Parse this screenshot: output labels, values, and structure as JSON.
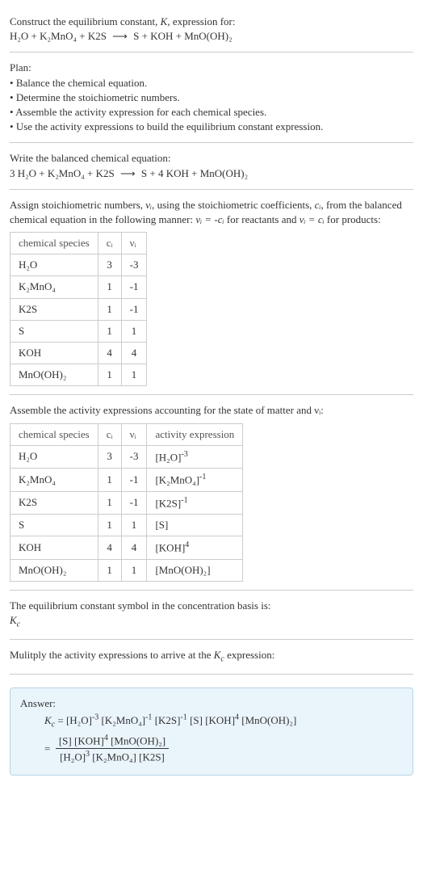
{
  "intro": {
    "line1": "Construct the equilibrium constant, ",
    "k": "K",
    "line1b": ", expression for:",
    "eq_lhs": "H₂O + K₂MnO₄ + K2S",
    "arrow": "⟶",
    "eq_rhs": "S + KOH + MnO(OH)₂"
  },
  "plan": {
    "heading": "Plan:",
    "items": [
      "Balance the chemical equation.",
      "Determine the stoichiometric numbers.",
      "Assemble the activity expression for each chemical species.",
      "Use the activity expressions to build the equilibrium constant expression."
    ]
  },
  "balanced": {
    "heading": "Write the balanced chemical equation:",
    "eq_lhs": "3 H₂O + K₂MnO₄ + K2S",
    "arrow": "⟶",
    "eq_rhs": "S + 4 KOH + MnO(OH)₂"
  },
  "assign": {
    "text1": "Assign stoichiometric numbers, ",
    "nu": "νᵢ",
    "text2": ", using the stoichiometric coefficients, ",
    "ci": "cᵢ",
    "text3": ", from the balanced chemical equation in the following manner: ",
    "rel1": "νᵢ = -cᵢ",
    "text4": " for reactants and ",
    "rel2": "νᵢ = cᵢ",
    "text5": " for products:"
  },
  "table1": {
    "headers": [
      "chemical species",
      "cᵢ",
      "νᵢ"
    ],
    "rows": [
      {
        "sp": "H₂O",
        "c": "3",
        "v": "-3"
      },
      {
        "sp": "K₂MnO₄",
        "c": "1",
        "v": "-1"
      },
      {
        "sp": "K2S",
        "c": "1",
        "v": "-1"
      },
      {
        "sp": "S",
        "c": "1",
        "v": "1"
      },
      {
        "sp": "KOH",
        "c": "4",
        "v": "4"
      },
      {
        "sp": "MnO(OH)₂",
        "c": "1",
        "v": "1"
      }
    ]
  },
  "assemble": {
    "text": "Assemble the activity expressions accounting for the state of matter and νᵢ:"
  },
  "table2": {
    "headers": [
      "chemical species",
      "cᵢ",
      "νᵢ",
      "activity expression"
    ],
    "rows": [
      {
        "sp": "H₂O",
        "c": "3",
        "v": "-3",
        "a_base": "[H₂O]",
        "a_exp": "-3"
      },
      {
        "sp": "K₂MnO₄",
        "c": "1",
        "v": "-1",
        "a_base": "[K₂MnO₄]",
        "a_exp": "-1"
      },
      {
        "sp": "K2S",
        "c": "1",
        "v": "-1",
        "a_base": "[K2S]",
        "a_exp": "-1"
      },
      {
        "sp": "S",
        "c": "1",
        "v": "1",
        "a_base": "[S]",
        "a_exp": ""
      },
      {
        "sp": "KOH",
        "c": "4",
        "v": "4",
        "a_base": "[KOH]",
        "a_exp": "4"
      },
      {
        "sp": "MnO(OH)₂",
        "c": "1",
        "v": "1",
        "a_base": "[MnO(OH)₂]",
        "a_exp": ""
      }
    ]
  },
  "symbol": {
    "text": "The equilibrium constant symbol in the concentration basis is:",
    "kc": "K_c"
  },
  "multiply": {
    "text": "Mulitply the activity expressions to arrive at the ",
    "kc": "K_c",
    "text2": " expression:"
  },
  "answer": {
    "label": "Answer:",
    "kc": "K_c",
    "line1_parts": [
      {
        "base": "[H₂O]",
        "exp": "-3"
      },
      {
        "base": " [K₂MnO₄]",
        "exp": "-1"
      },
      {
        "base": " [K2S]",
        "exp": "-1"
      },
      {
        "base": " [S]",
        "exp": ""
      },
      {
        "base": " [KOH]",
        "exp": "4"
      },
      {
        "base": " [MnO(OH)₂]",
        "exp": ""
      }
    ],
    "frac_num_parts": [
      {
        "base": "[S]",
        "exp": ""
      },
      {
        "base": " [KOH]",
        "exp": "4"
      },
      {
        "base": " [MnO(OH)₂]",
        "exp": ""
      }
    ],
    "frac_den_parts": [
      {
        "base": "[H₂O]",
        "exp": "3"
      },
      {
        "base": " [K₂MnO₄]",
        "exp": ""
      },
      {
        "base": " [K2S]",
        "exp": ""
      }
    ]
  }
}
